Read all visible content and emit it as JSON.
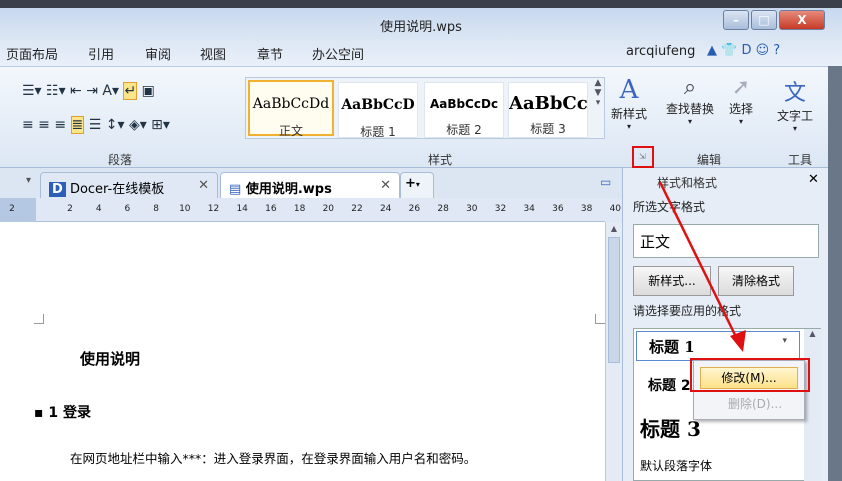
{
  "window": {
    "title": "使用说明.wps",
    "minimize": "–",
    "maximize": "□",
    "close": "X"
  },
  "menu": [
    "页面布局",
    "引用",
    "审阅",
    "视图",
    "章节",
    "办公空间"
  ],
  "user": "arcqiufeng",
  "ribbon": {
    "paragraph_label": "段落",
    "styles_label": "样式",
    "edit_label": "编辑",
    "tools_label": "工具",
    "styles": [
      {
        "sample": "AaBbCcDd",
        "name": "正文"
      },
      {
        "sample": "AaBbCcD",
        "name": "标题 1"
      },
      {
        "sample": "AaBbCcDc",
        "name": "标题 2"
      },
      {
        "sample": "AaBbCc",
        "name": "标题 3"
      }
    ],
    "new_style": "新样式",
    "find_replace": "查找替换",
    "select": "选择",
    "text_tools": "文字工"
  },
  "tabs": [
    {
      "label": "Docer-在线模板"
    },
    {
      "label": "使用说明.wps"
    }
  ],
  "ruler_ticks": [
    "2",
    "2",
    "4",
    "6",
    "8",
    "10",
    "12",
    "14",
    "16",
    "18",
    "20",
    "22",
    "24",
    "26",
    "28",
    "30",
    "32",
    "34",
    "36",
    "38",
    "40"
  ],
  "document": {
    "title": "使用说明",
    "heading": "1 登录",
    "body": "在网页地址栏中输入***：进入登录界面，在登录界面输入用户名和密码。"
  },
  "pane": {
    "title": "样式和格式",
    "selected_label": "所选文字格式",
    "selected_value": "正文",
    "new_style_btn": "新样式...",
    "clear_btn": "清除格式",
    "apply_label": "请选择要应用的格式",
    "list": [
      "标题 1",
      "标题 2",
      "标题 3",
      "默认段落字体"
    ],
    "context_menu": {
      "modify": "修改(M)...",
      "delete": "删除(D)..."
    }
  }
}
